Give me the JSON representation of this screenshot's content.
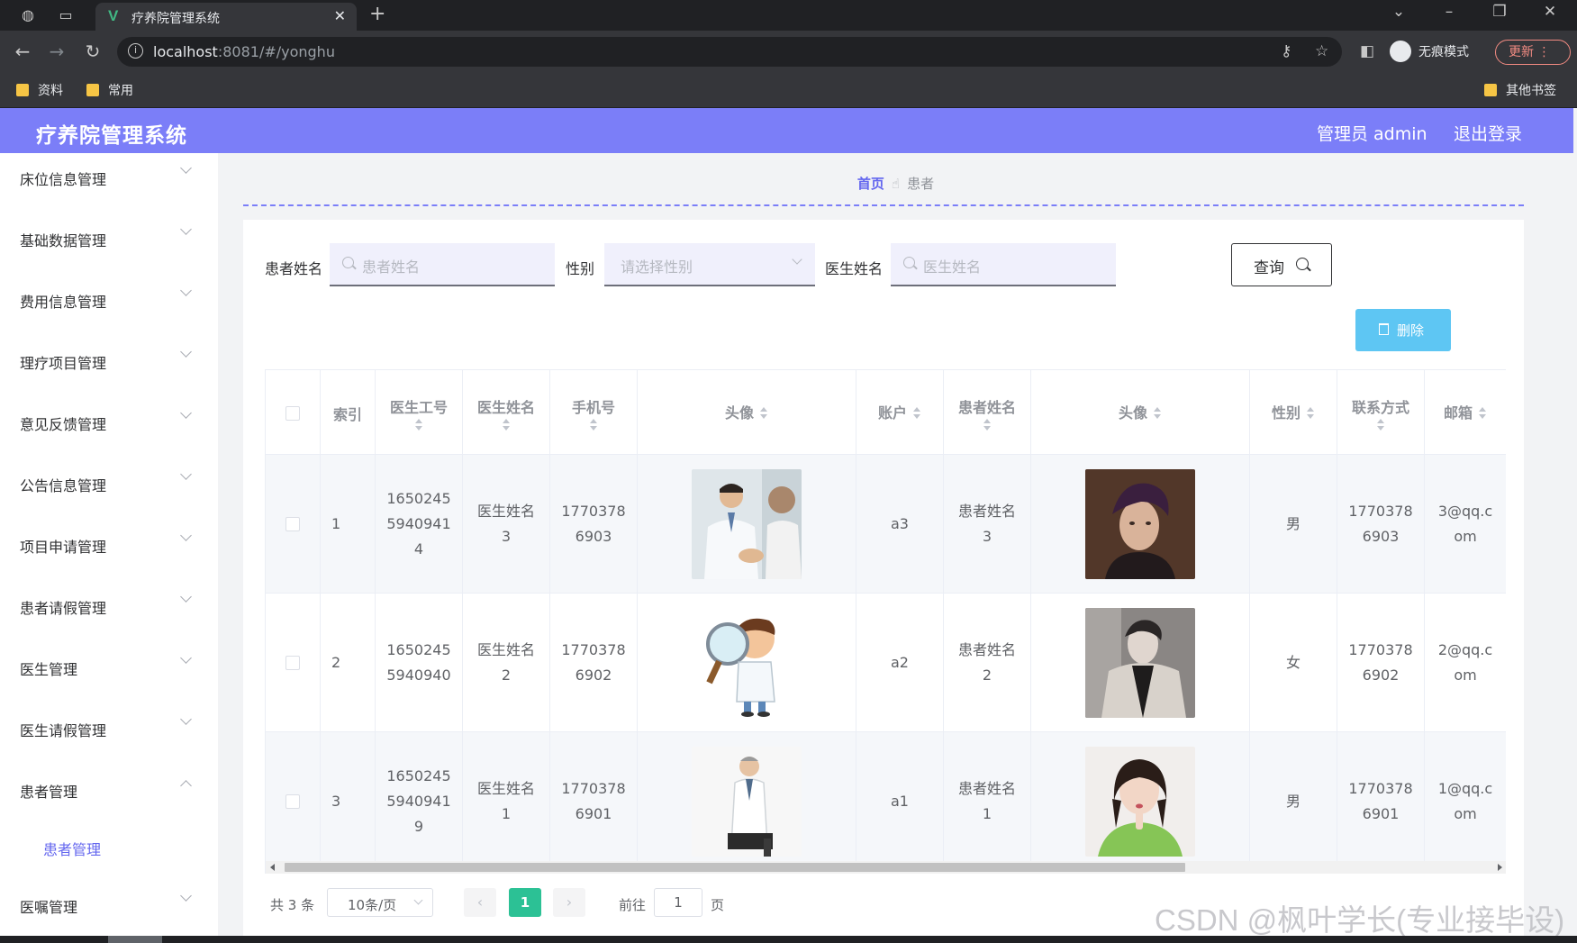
{
  "browser": {
    "tab_title": "疗养院管理系统",
    "tab_logo": "V",
    "url_host": "localhost",
    "url_rest": ":8081/#/yonghu",
    "profile_label": "无痕模式",
    "update_label": "更新",
    "bookmarks": [
      "资料",
      "常用"
    ],
    "other_bookmarks": "其他书签"
  },
  "header": {
    "title": "疗养院管理系统",
    "user": "管理员 admin",
    "logout": "退出登录"
  },
  "sidebar": {
    "items": [
      {
        "label": "床位信息管理"
      },
      {
        "label": "基础数据管理"
      },
      {
        "label": "费用信息管理"
      },
      {
        "label": "理疗项目管理"
      },
      {
        "label": "意见反馈管理"
      },
      {
        "label": "公告信息管理"
      },
      {
        "label": "项目申请管理"
      },
      {
        "label": "患者请假管理"
      },
      {
        "label": "医生管理"
      },
      {
        "label": "医生请假管理"
      },
      {
        "label": "患者管理"
      },
      {
        "label": "医嘱管理"
      }
    ],
    "active_sub": "患者管理"
  },
  "breadcrumb": {
    "home": "首页",
    "current": "患者"
  },
  "search": {
    "patient_label": "患者姓名",
    "patient_placeholder": "患者姓名",
    "gender_label": "性别",
    "gender_placeholder": "请选择性别",
    "doctor_label": "医生姓名",
    "doctor_placeholder": "医生姓名",
    "query_label": "查询"
  },
  "actions": {
    "delete_label": "删除"
  },
  "table": {
    "columns": {
      "index": "索引",
      "doctor_id": "医生工号",
      "doctor_name": "医生姓名",
      "phone": "手机号",
      "doctor_avatar": "头像",
      "account": "账户",
      "patient_name": "患者姓名",
      "patient_avatar": "头像",
      "gender": "性别",
      "contact": "联系方式",
      "email": "邮箱"
    },
    "rows": [
      {
        "index": "1",
        "doctor_id": "16502455940941 4",
        "doctor_name": "医生姓名3",
        "phone": "17703786903",
        "account": "a3",
        "patient_name": "患者姓名3",
        "gender": "男",
        "contact": "17703786903",
        "email": "3@qq.com",
        "doctor_img": "doctor-consult-photo",
        "patient_img": "young-man-portrait"
      },
      {
        "index": "2",
        "doctor_id": "16502455940940",
        "doctor_name": "医生姓名2",
        "phone": "17703786902",
        "account": "a2",
        "patient_name": "患者姓名2",
        "gender": "女",
        "contact": "17703786902",
        "email": "2@qq.com",
        "doctor_img": "cartoon-doctor-magnifier",
        "patient_img": "man-in-coat-portrait"
      },
      {
        "index": "3",
        "doctor_id": "16502455940941 9",
        "doctor_name": "医生姓名1",
        "phone": "17703786901",
        "account": "a1",
        "patient_name": "患者姓名1",
        "gender": "男",
        "contact": "17703786901",
        "email": "1@qq.com",
        "doctor_img": "doctor-seated-photo",
        "patient_img": "girl-green-sweater-portrait"
      }
    ]
  },
  "pagination": {
    "total": "共 3 条",
    "page_size": "10条/页",
    "prev": "‹",
    "current": "1",
    "next": "›",
    "goto_label": "前往",
    "goto_value": "1",
    "goto_unit": "页"
  },
  "watermark": "CSDN @枫叶学长(专业接毕设)",
  "colors": {
    "header_bg": "#7b7ef8",
    "accent": "#6467ef",
    "delete_btn": "#5ec6f3",
    "page_active": "#2cc195"
  }
}
